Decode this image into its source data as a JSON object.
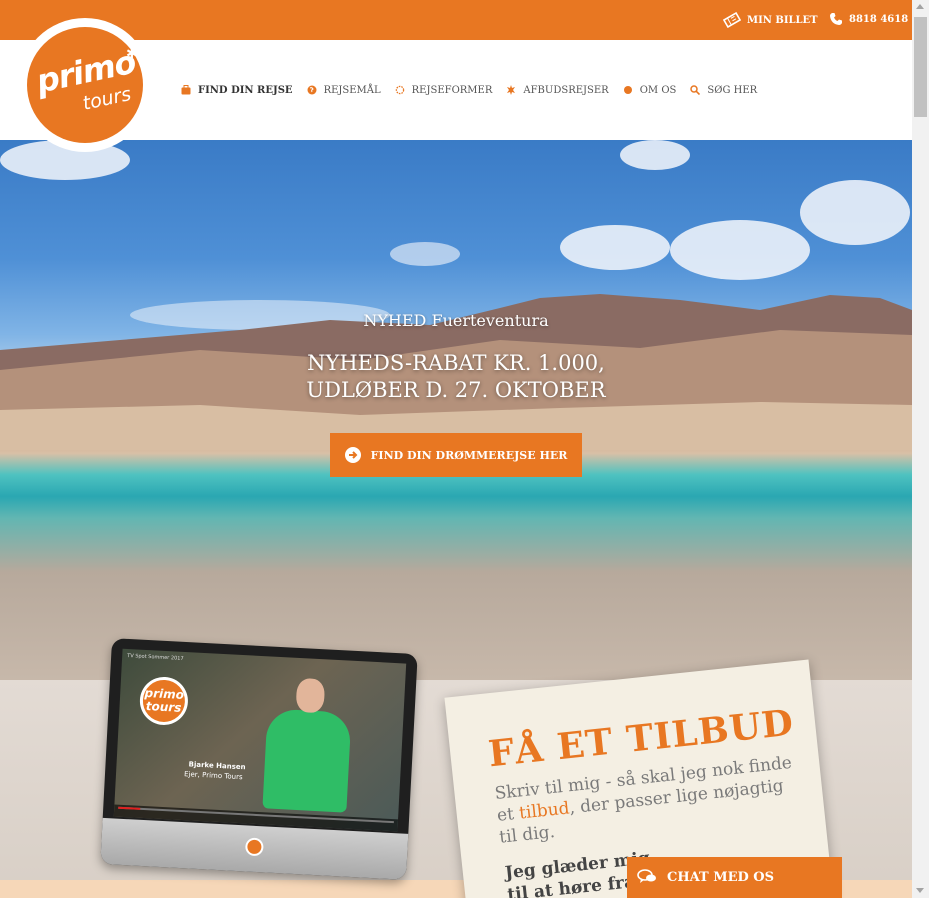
{
  "topbar": {
    "ticket_label": "MIN BILLET",
    "ticket_icon": "ticket-icon",
    "phone_label": "8818 4618",
    "phone_icon": "phone-icon"
  },
  "brand": {
    "logo_primo": "primo",
    "logo_tours": "tours",
    "accent": "#e87722"
  },
  "nav": {
    "items": [
      {
        "label": "FIND DIN REJSE",
        "icon": "suitcase-icon"
      },
      {
        "label": "REJSEMÅL",
        "icon": "globe-icon"
      },
      {
        "label": "REJSEFORMER",
        "icon": "sun-outline-icon"
      },
      {
        "label": "AFBUDSREJSER",
        "icon": "starburst-icon"
      },
      {
        "label": "OM OS",
        "icon": "dot-icon"
      },
      {
        "label": "SØG HER",
        "icon": "search-icon"
      }
    ]
  },
  "hero": {
    "subtitle": "NYHED Fuerteventura",
    "title_line1": "NYHEDS-RABAT KR. 1.000,",
    "title_line2": "UDLØBER D. 27. OKTOBER",
    "cta_label": "FIND DIN DRØMMEREJSE HER",
    "cta_icon": "arrow-circle-icon"
  },
  "video": {
    "tag": "TV Spot Sommer 2017",
    "logo_text": "primo tours",
    "person_name": "Bjarke Hansen",
    "person_role": "Ejer, Primo Tours",
    "progress": 0.08
  },
  "offer": {
    "title": "FÅ ET TILBUD",
    "text_before": "Skriv til mig - så skal jeg nok finde et ",
    "text_highlight": "tilbud",
    "text_after": ", der passer lige nøjagtig til dig.",
    "bold_line1": "Jeg glæder mig",
    "bold_line2": "til at høre fra"
  },
  "chat": {
    "label": "CHAT MED OS",
    "icon": "chat-bubbles-icon"
  }
}
